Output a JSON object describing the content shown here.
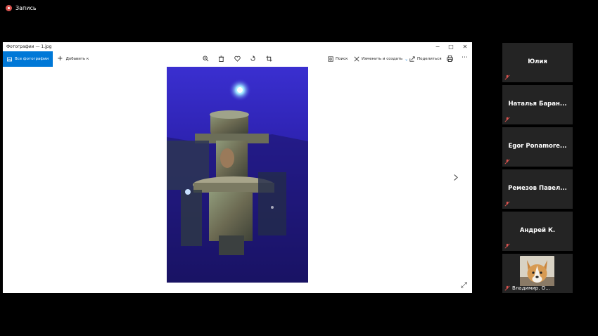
{
  "recording": {
    "label": "Запись"
  },
  "window": {
    "title": "Фотографии — 1.jpg",
    "controls": {
      "minimize": "−",
      "maximize": "□",
      "close": "✕"
    }
  },
  "toolbar": {
    "all_photos": "Все фотографии",
    "add_to": "Добавить к",
    "search": "Поиск",
    "edit_create": "Изменить и создать",
    "share": "Поделиться"
  },
  "participants": [
    {
      "name": "Юлия"
    },
    {
      "name": "Наталья Баран..."
    },
    {
      "name": "Egor Ponamore..."
    },
    {
      "name": "Ремезов Павел..."
    },
    {
      "name": "Андрей К."
    },
    {
      "name": "Владимир. О..."
    }
  ],
  "colors": {
    "accent": "#0078d7",
    "tile_bg": "#242424",
    "mic_muted": "#d9534f"
  }
}
